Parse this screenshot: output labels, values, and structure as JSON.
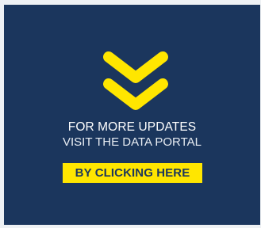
{
  "promo": {
    "heading": "FOR MORE UPDATES",
    "subheading": "VISIT THE DATA PORTAL",
    "cta_label": "BY CLICKING HERE"
  },
  "icons": {
    "chevron": "double-chevron-down-icon"
  },
  "colors": {
    "panel_background": "#1b365d",
    "accent": "#ffe600",
    "text": "#ffffff"
  }
}
